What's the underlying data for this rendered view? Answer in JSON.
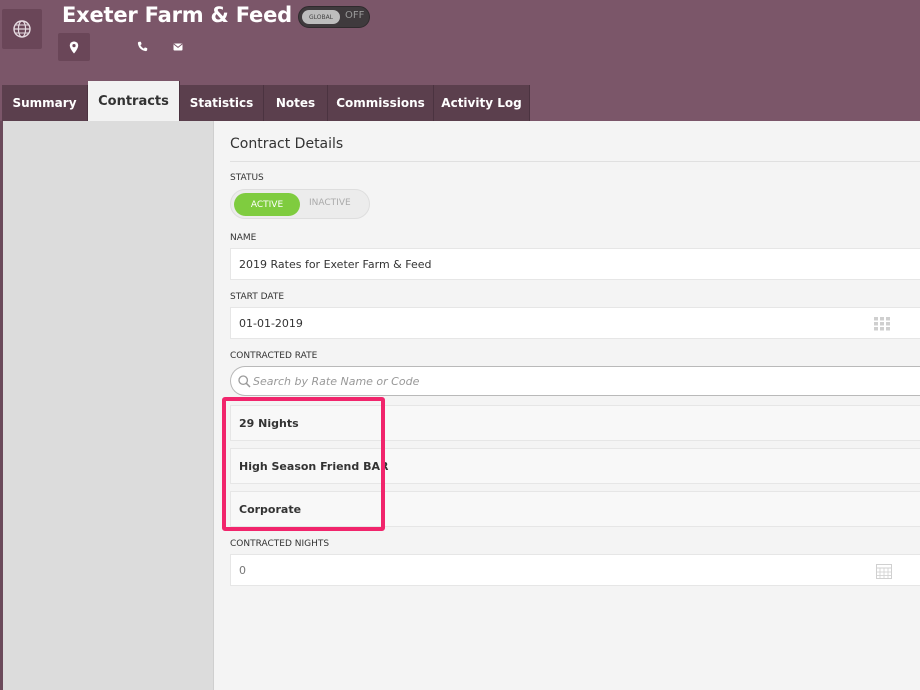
{
  "header": {
    "title": "Exeter Farm & Feed",
    "global_toggle": {
      "pill_label": "GLOBAL",
      "state_label": "OFF"
    },
    "icons": [
      "globe-icon",
      "map-pin-icon",
      "phone-icon",
      "mail-icon"
    ]
  },
  "tabs": [
    {
      "label": "Summary",
      "active": false
    },
    {
      "label": "Contracts",
      "active": true
    },
    {
      "label": "Statistics",
      "active": false
    },
    {
      "label": "Notes",
      "active": false
    },
    {
      "label": "Commissions",
      "active": false
    },
    {
      "label": "Activity Log",
      "active": false
    }
  ],
  "contract": {
    "section_title": "Contract Details",
    "status": {
      "label": "STATUS",
      "active_label": "ACTIVE",
      "inactive_label": "INACTIVE"
    },
    "name": {
      "label": "NAME",
      "value": "2019 Rates for Exeter Farm & Feed"
    },
    "start_date": {
      "label": "START DATE",
      "value": "01-01-2019"
    },
    "contracted_rate": {
      "label": "CONTRACTED RATE",
      "placeholder": "Search by Rate Name or Code",
      "results": [
        "29 Nights",
        "High Season Friend BAR",
        "Corporate"
      ]
    },
    "contracted_nights": {
      "label": "CONTRACTED NIGHTS",
      "value": "0"
    }
  },
  "colors": {
    "header_bg": "#7b5669",
    "tab_bg": "#5b3f4d",
    "active_toggle": "#7fcc3f",
    "highlight": "#f1256c"
  }
}
